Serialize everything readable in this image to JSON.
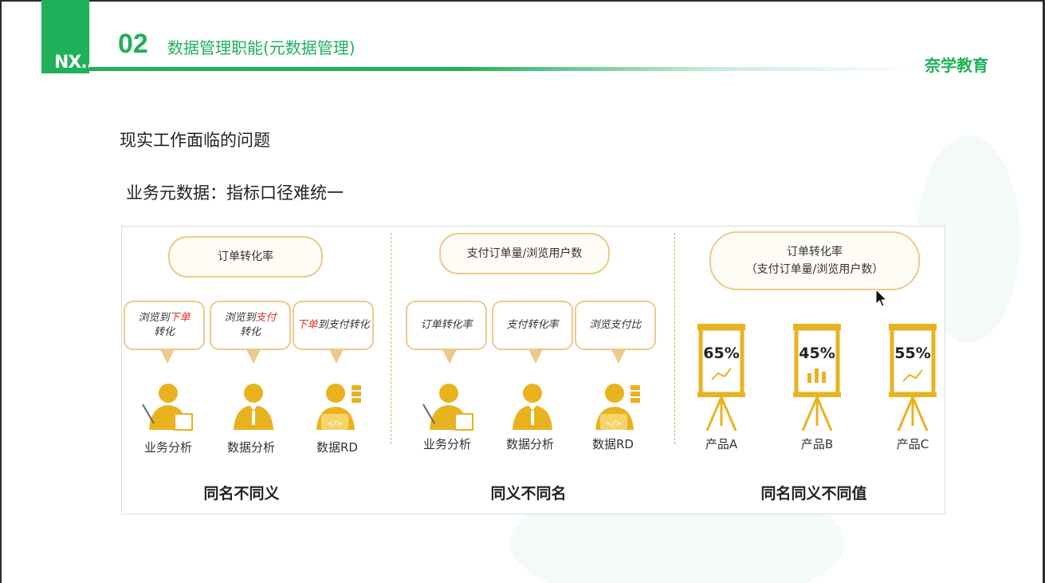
{
  "header": {
    "logo_text": "NX...",
    "section_number": "02",
    "title": "数据管理职能(元数据管理)",
    "brand": "奈学教育"
  },
  "subtitle": "现实工作面临的问题",
  "heading": "业务元数据：指标口径难统一",
  "sections": [
    {
      "cloud": "订单转化率",
      "bubbles": [
        {
          "pre": "浏览到",
          "hl": "下单",
          "post": "转化"
        },
        {
          "pre": "浏览到",
          "hl": "支付",
          "post": "转化"
        },
        {
          "pre": "",
          "hl": "下单",
          "post": "到支付转化"
        }
      ],
      "roles": [
        "业务分析",
        "数据分析",
        "数据RD"
      ],
      "caption": "同名不同义"
    },
    {
      "cloud": "支付订单量/浏览用户数",
      "bubbles": [
        "订单转化率",
        "支付转化率",
        "浏览支付比"
      ],
      "roles": [
        "业务分析",
        "数据分析",
        "数据RD"
      ],
      "caption": "同义不同名"
    },
    {
      "cloud_line1": "订单转化率",
      "cloud_line2": "（支付订单量/浏览用户数）",
      "boards": [
        {
          "value": "65%",
          "product": "产品A",
          "icon": "line-chart-icon"
        },
        {
          "value": "45%",
          "product": "产品B",
          "icon": "bar-chart-icon"
        },
        {
          "value": "55%",
          "product": "产品C",
          "icon": "line-chart-icon"
        }
      ],
      "caption": "同名同义不同值"
    }
  ],
  "colors": {
    "brand_green": "#1fb05a",
    "accent_gold": "#e9b21f",
    "highlight_red": "#e0332c"
  }
}
